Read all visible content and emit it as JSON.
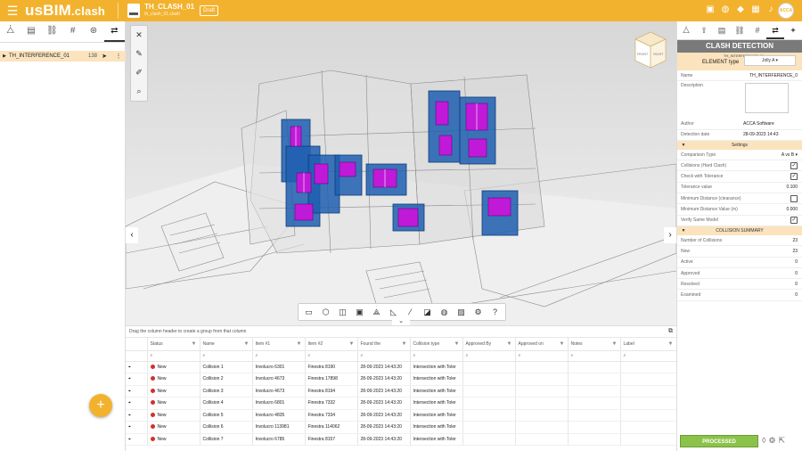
{
  "app": {
    "logo": "usBIM",
    "logo_sub": ".clash",
    "project_name": "TH_CLASH_01",
    "project_file": "th_clash_01.clash",
    "draft_label": "Draft",
    "avatar_initials": "ACCA"
  },
  "topbar": {
    "icons": [
      "files-icon",
      "globe-icon",
      "layers-icon",
      "cubes-icon",
      "bell-icon"
    ]
  },
  "left_panel": {
    "tabs": [
      {
        "icon": "model-tree-icon",
        "glyph": "⧊"
      },
      {
        "icon": "document-icon",
        "glyph": "▤"
      },
      {
        "icon": "link-icon",
        "glyph": "⛓"
      },
      {
        "icon": "hash-icon",
        "glyph": "#"
      },
      {
        "icon": "network-icon",
        "glyph": "⊛"
      },
      {
        "icon": "clash-icon",
        "glyph": "⇄"
      }
    ],
    "tree_item": {
      "name": "TH_INTERFERENCE_01",
      "count": "138"
    },
    "add_label": "+"
  },
  "viewport": {
    "cube": {
      "front": "FRONT",
      "right": "RIGHT"
    },
    "tools": [
      "close-icon",
      "brush-icon",
      "eraser-icon",
      "zoom-icon"
    ],
    "bottom_tools": [
      "video-icon",
      "cube-icon",
      "section-icon",
      "box-icon",
      "explode-icon",
      "measure-icon",
      "paint-icon",
      "clip-icon",
      "globe-icon",
      "image-icon",
      "gear-icon",
      "help-icon"
    ]
  },
  "grid": {
    "group_hint": "Drag the column header to create a group from that column",
    "columns": [
      "Status",
      "Name",
      "Item #1",
      "Item #2",
      "Found the",
      "Collision type",
      "Approved By",
      "Approved on",
      "Notes",
      "Label"
    ],
    "rows": [
      {
        "status": "New",
        "name": "Collision 1",
        "item1": "Involucro 6301",
        "item2": "Finestra 8190",
        "found": "28-09-2023 14:43:20",
        "type": "Intersection with Toler"
      },
      {
        "status": "New",
        "name": "Collision 2",
        "item1": "Involucro 4673",
        "item2": "Finestra 17898",
        "found": "28-09-2023 14:43:20",
        "type": "Intersection with Toler"
      },
      {
        "status": "New",
        "name": "Collision 3",
        "item1": "Involucro 4673",
        "item2": "Finestra 8194",
        "found": "28-09-2023 14:43:20",
        "type": "Intersection with Toler"
      },
      {
        "status": "New",
        "name": "Collision 4",
        "item1": "Involucro 6801",
        "item2": "Finestra 7332",
        "found": "28-09-2023 14:43:20",
        "type": "Intersection with Toler"
      },
      {
        "status": "New",
        "name": "Collision 5",
        "item1": "Involucro 4835",
        "item2": "Finestra 7334",
        "found": "28-09-2023 14:43:20",
        "type": "Intersection with Toler"
      },
      {
        "status": "New",
        "name": "Collision 6",
        "item1": "Involucro 113981",
        "item2": "Finestra 114062",
        "found": "28-09-2023 14:43:20",
        "type": "Intersection with Toler"
      },
      {
        "status": "New",
        "name": "Collision 7",
        "item1": "Involucro 6785",
        "item2": "Finestra 8157",
        "found": "28-09-2023 14:43:20",
        "type": "Intersection with Toler"
      }
    ],
    "colors": {
      "status_new": "#d32f2f"
    }
  },
  "right_panel": {
    "tabs": [
      {
        "icon": "model-icon",
        "glyph": "⧊"
      },
      {
        "icon": "export-icon",
        "glyph": "⇪"
      },
      {
        "icon": "document-icon",
        "glyph": "▤"
      },
      {
        "icon": "link-icon",
        "glyph": "⛓"
      },
      {
        "icon": "hash-icon",
        "glyph": "#"
      },
      {
        "icon": "clash-icon",
        "glyph": "⇄"
      },
      {
        "icon": "settings-cube-icon",
        "glyph": "✦"
      }
    ],
    "title": "CLASH DETECTION",
    "element_type_small": "TH_INTERFERENCE_01",
    "element_type_label": "ELEMENT type",
    "element_type_value": "Jolly A",
    "props": {
      "name_label": "Name",
      "name_value": "TH_INTERFERENCE_0",
      "description_label": "Description",
      "author_label": "Author",
      "author_value": "ACCA Software",
      "date_label": "Detection date",
      "date_value": "28-09-2023 14:43"
    },
    "settings": {
      "title": "Settings",
      "comparison_label": "Comparison Type",
      "comparison_value": "A vs B",
      "hard_clash_label": "Collisions (Hard Clash)",
      "tolerance_check_label": "Check with Tolerance",
      "tolerance_value_label": "Tolerance value",
      "tolerance_value": "0.100",
      "min_distance_label": "Minimum Distance (clearance)",
      "min_distance_value_label": "Minimum Distance Value (m)",
      "min_distance_value": "0.000",
      "same_model_label": "Verify Same Model"
    },
    "summary": {
      "title": "COLLISION SUMMARY",
      "rows": [
        {
          "label": "Number of Collisions",
          "value": "23"
        },
        {
          "label": "New",
          "value": "23"
        },
        {
          "label": "Active",
          "value": "0"
        },
        {
          "label": "Approved",
          "value": "0"
        },
        {
          "label": "Resolved",
          "value": "0"
        },
        {
          "label": "Examined",
          "value": "0"
        }
      ]
    },
    "processed_label": "PROCESSED"
  },
  "colors": {
    "accent": "#f3b22e",
    "highlight": "#fbe3bd",
    "clash_blue": "#1f5fb0",
    "clash_magenta": "#b000d0",
    "processed": "#8bc34a"
  }
}
